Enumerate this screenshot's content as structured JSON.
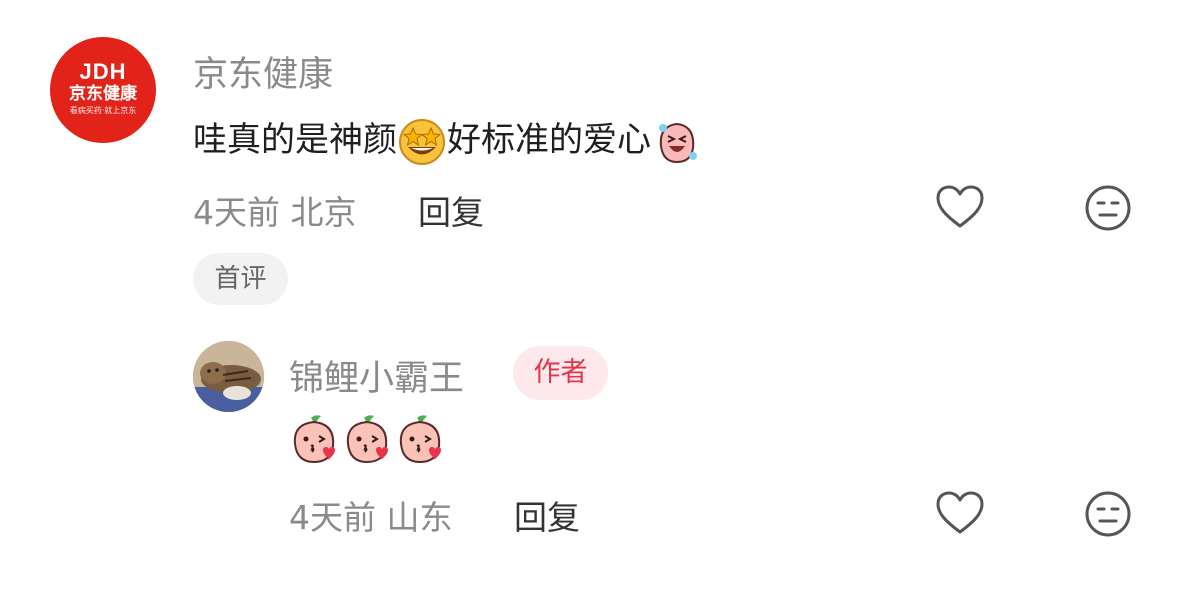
{
  "comment": {
    "author": "京东健康",
    "avatar_logo": "JDH",
    "avatar_name": "京东健康",
    "avatar_tagline": "看病买药·就上京东",
    "text_part1": "哇真的是神颜",
    "text_part2": "好标准的爱心",
    "emoji_1": "star-struck-emoji",
    "emoji_2": "laughing-peach-emoji",
    "time": "4天前",
    "location": "北京",
    "reply_label": "回复",
    "badge": "首评"
  },
  "reply": {
    "author": "锦鲤小霸王",
    "author_badge": "作者",
    "emojis": [
      "kiss-peach-emoji",
      "kiss-peach-emoji",
      "kiss-peach-emoji"
    ],
    "time": "4天前",
    "location": "山东",
    "reply_label": "回复"
  },
  "colors": {
    "jd_red": "#e2231a",
    "author_badge_text": "#e4344b",
    "author_badge_bg": "#fde8ec",
    "meta_gray": "#8a8a8a"
  },
  "icons": {
    "like": "heart-outline-icon",
    "dislike": "neutral-face-icon"
  }
}
